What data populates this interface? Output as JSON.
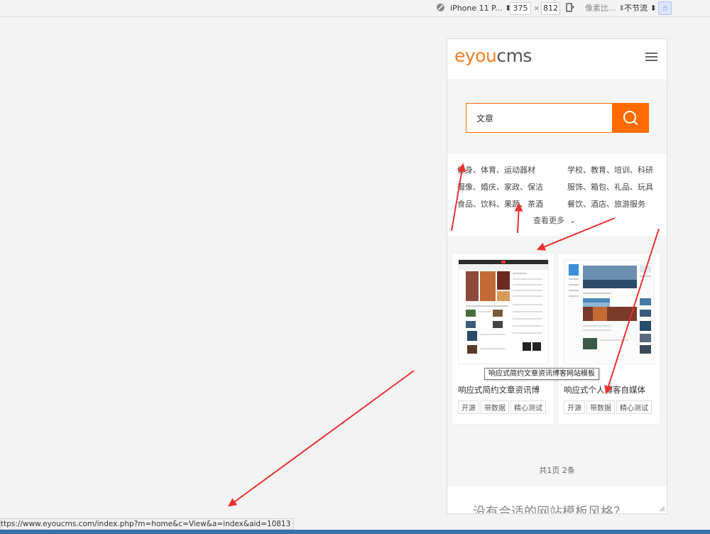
{
  "devtools": {
    "device": "iPhone 11 P...",
    "width": "375",
    "times": "×",
    "height": "812",
    "zoom": "像素比...",
    "throttle": "不节流"
  },
  "site": {
    "logo_e": "e",
    "logo_you": "you",
    "logo_cms": "cms",
    "search_value": "文章",
    "categories": [
      "健身、体育、运动器材",
      "学校、教育、培训、科研",
      "摄像、婚庆、家政、保洁",
      "服饰、箱包、礼品、玩具",
      "食品、饮料、果蔬、茶酒",
      "餐饮、酒店、旅游服务"
    ],
    "more": "查看更多",
    "cards": [
      {
        "title": "响应式简约文章资讯博",
        "tags": [
          "开源",
          "带数据",
          "精心测试"
        ]
      },
      {
        "title": "响应式个人博客自媒体",
        "tags": [
          "开源",
          "带数据",
          "精心测试"
        ]
      }
    ],
    "pager": "共1页 2条",
    "footer_text": "没有合适的网站模板风格？"
  },
  "tooltip": "响应式简约文章资讯博客网站模板",
  "status_url": "ttps://www.eyoucms.com/index.php?m=home&c=View&a=index&aid=10813",
  "colors": {
    "accent": "#ff6b00",
    "arrow": "#e8312f"
  }
}
